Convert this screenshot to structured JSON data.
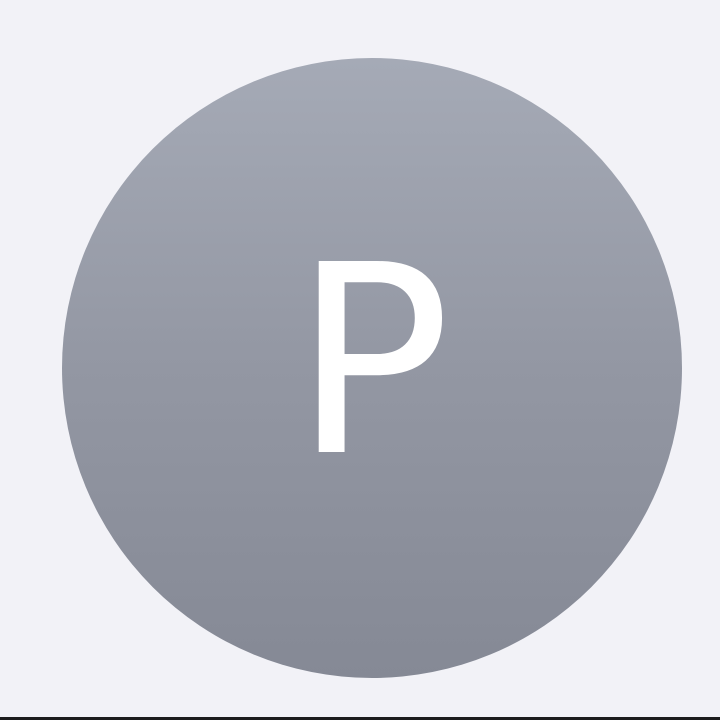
{
  "contact": {
    "initial": "P"
  },
  "colors": {
    "background": "#f2f2f7",
    "avatar_top": "#a5aab6",
    "avatar_bottom": "#858995",
    "initial_text": "#ffffff"
  }
}
